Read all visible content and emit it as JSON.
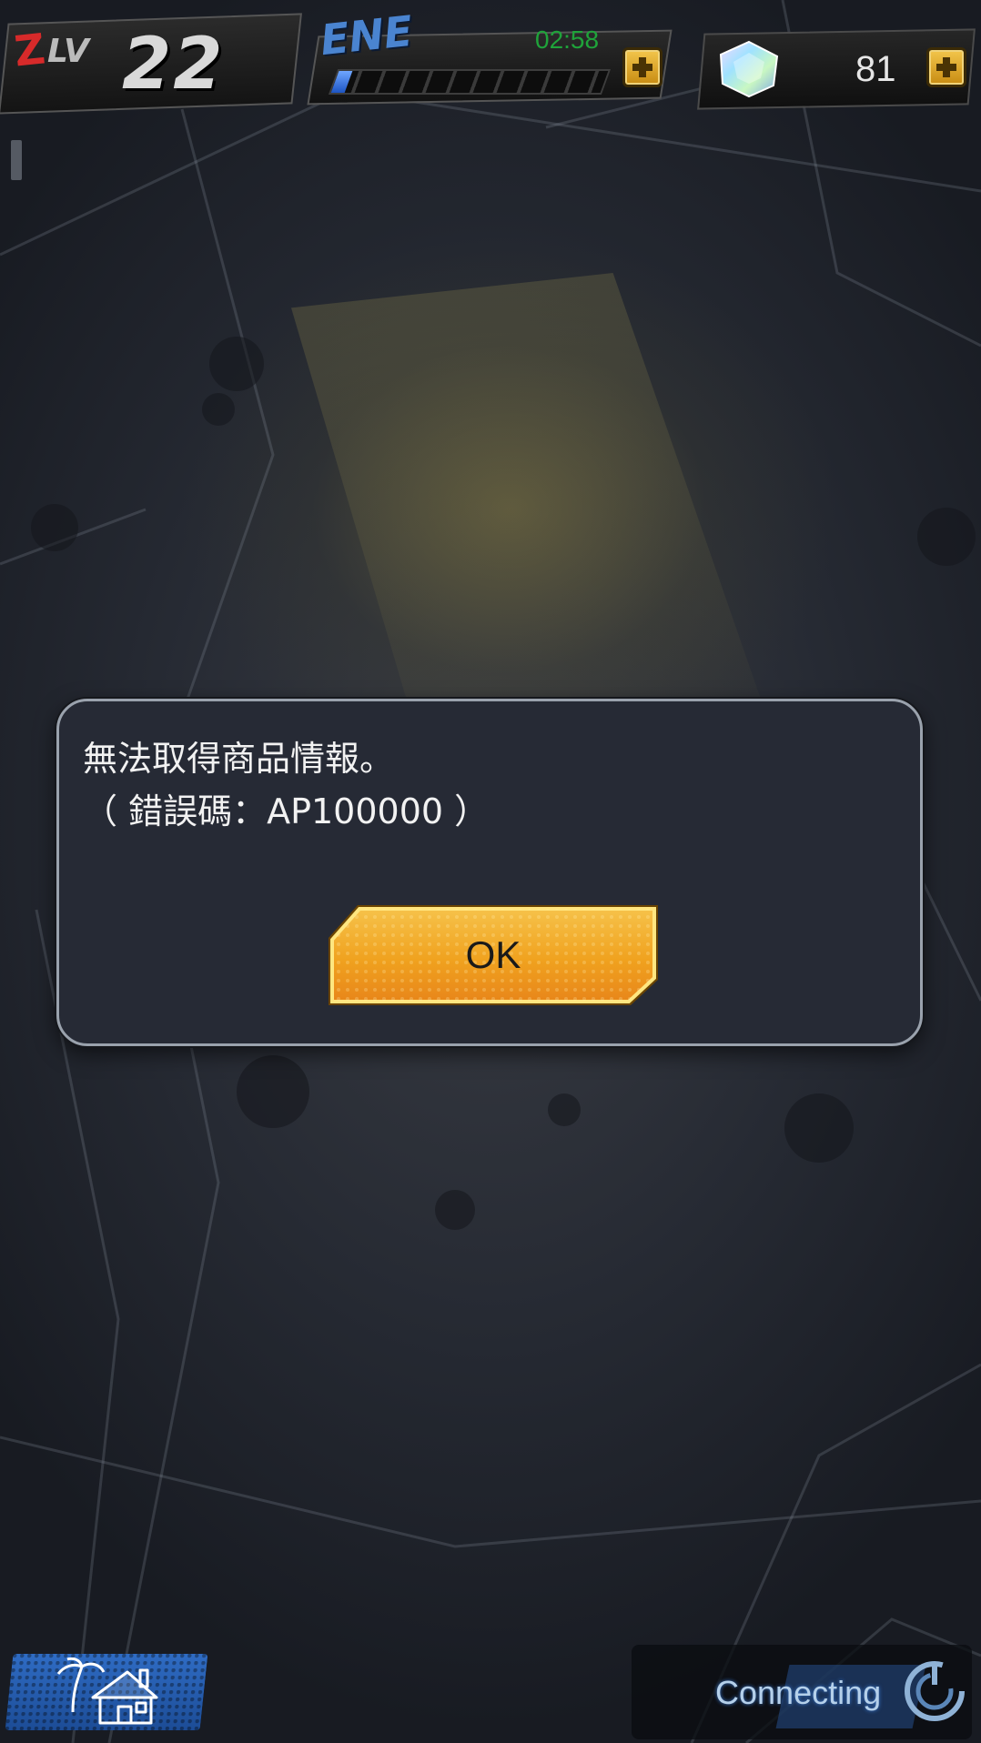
{
  "hud": {
    "level_prefix": "Z",
    "level_label": "LV",
    "level": "22",
    "energy_label": "ENE",
    "energy_timer": "02:58",
    "energy_fill": 0.05,
    "gem_count": "81",
    "icons": {
      "energy_add": "plus-icon",
      "gem": "crystal-gem-icon",
      "gem_add": "plus-icon"
    }
  },
  "dialog": {
    "line1": "無法取得商品情報。",
    "line2": "（ 錯誤碼：AP100000 ）",
    "ok_label": "OK"
  },
  "bottom": {
    "home_icon": "home-island-icon",
    "connecting_text": "Connecting",
    "connecting_icon": "loading-spinner-icon"
  },
  "colors": {
    "dialog_bg": "#262a35",
    "dialog_border": "#9aa2ad",
    "ok_button": "#f0a928",
    "energy_timer": "#1fa33a",
    "energy_label": "#4a84d0"
  }
}
